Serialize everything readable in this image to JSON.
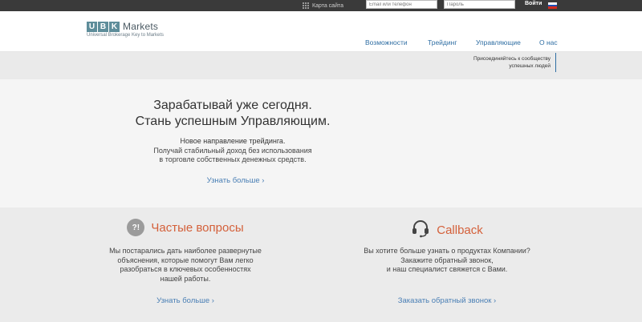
{
  "topbar": {
    "sitemap_label": "Карта сайта",
    "email_placeholder": "Email или телефон",
    "password_placeholder": "Пароль",
    "login_label": "Войти",
    "flag_colors": [
      "#ffffff",
      "#1f4fb5",
      "#d52b1e"
    ]
  },
  "header": {
    "logo_letters": [
      "U",
      "B",
      "K"
    ],
    "logo_word": "Markets",
    "logo_tagline": "Universal Brokerage Key to Markets",
    "nav": [
      "Возможности",
      "Трейдинг",
      "Управляющие",
      "О нас"
    ]
  },
  "banner": {
    "community_line1": "Присоединяйтесь к сообществу",
    "community_line2": "успешных людей"
  },
  "hero": {
    "title_line1": "Зарабатывай уже сегодня.",
    "title_line2": "Стань успешным Управляющим.",
    "sub_line1": "Новое направление трейдинга.",
    "sub_line2": "Получай стабильный доход без использования",
    "sub_line3": "в торговле собственных денежных средств.",
    "more_link": "Узнать больше ›"
  },
  "faq": {
    "icon_text": "?!",
    "title": "Частые вопросы",
    "line1": "Мы постарались дать наиболее развернутые",
    "line2": "объяснения, которые помогут Вам легко",
    "line3": "разобраться в ключевых особенностях",
    "line4": "нашей работы.",
    "link": "Узнать больше ›"
  },
  "callback": {
    "title": "Callback",
    "line1": "Вы хотите больше узнать о продуктах Компании?",
    "line2": "Закажите обратный звонок,",
    "line3": "и наш специалист свяжется с Вами.",
    "link": "Заказать обратный звонок ›"
  },
  "colors": {
    "accent": "#4a7fb5",
    "title_orange": "#d4603a",
    "topbar": "#3a3a3a"
  }
}
